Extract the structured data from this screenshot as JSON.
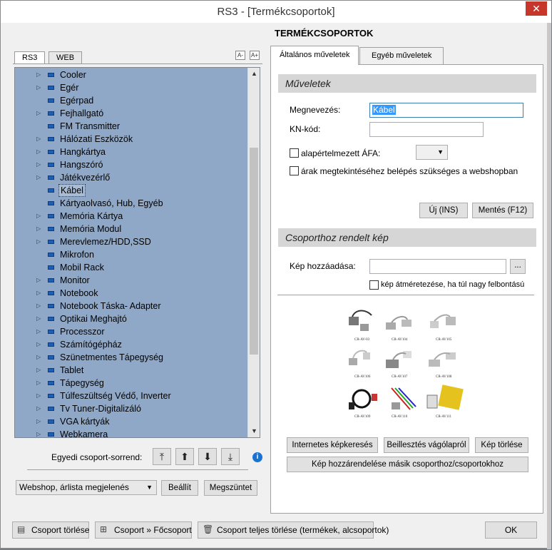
{
  "window": {
    "title": "RS3 - [Termékcsoportok]"
  },
  "heading": "TERMÉKCSOPORTOK",
  "left_tabs": [
    {
      "label": "RS3",
      "active": true
    },
    {
      "label": "WEB",
      "active": false
    }
  ],
  "tree": {
    "selected": "Kábel",
    "items": [
      {
        "label": "Cooler",
        "expandable": true
      },
      {
        "label": "Egér",
        "expandable": true
      },
      {
        "label": "Egérpad",
        "expandable": false
      },
      {
        "label": "Fejhallgató",
        "expandable": true
      },
      {
        "label": "FM Transmitter",
        "expandable": false
      },
      {
        "label": "Hálózati Eszközök",
        "expandable": true
      },
      {
        "label": "Hangkártya",
        "expandable": true
      },
      {
        "label": "Hangszóró",
        "expandable": true
      },
      {
        "label": "Játékvezérlő",
        "expandable": true
      },
      {
        "label": "Kábel",
        "expandable": false
      },
      {
        "label": "Kártyaolvasó, Hub, Egyéb",
        "expandable": false
      },
      {
        "label": "Memória Kártya",
        "expandable": true
      },
      {
        "label": "Memória Modul",
        "expandable": true
      },
      {
        "label": "Merevlemez/HDD,SSD",
        "expandable": true
      },
      {
        "label": "Mikrofon",
        "expandable": false
      },
      {
        "label": "Mobil Rack",
        "expandable": false
      },
      {
        "label": "Monitor",
        "expandable": true
      },
      {
        "label": "Notebook",
        "expandable": true
      },
      {
        "label": "Notebook Táska- Adapter",
        "expandable": true
      },
      {
        "label": "Optikai Meghajtó",
        "expandable": true
      },
      {
        "label": "Processzor",
        "expandable": true
      },
      {
        "label": "Számítógépház",
        "expandable": true
      },
      {
        "label": "Szünetmentes Tápegység",
        "expandable": true
      },
      {
        "label": "Tablet",
        "expandable": true
      },
      {
        "label": "Tápegység",
        "expandable": true
      },
      {
        "label": "Túlfeszültség Védő, Inverter",
        "expandable": true
      },
      {
        "label": "Tv Tuner-Digitalizáló",
        "expandable": true
      },
      {
        "label": "VGA kártyák",
        "expandable": true
      },
      {
        "label": "Webkamera",
        "expandable": true
      }
    ]
  },
  "sort": {
    "label": "Egyedi csoport-sorrend:"
  },
  "display_select": {
    "value": "Webshop, árlista megjelenés"
  },
  "left_buttons": {
    "set": "Beállít",
    "cancel": "Megszüntet"
  },
  "right_tabs": [
    {
      "label": "Általános műveletek",
      "active": true
    },
    {
      "label": "Egyéb műveletek",
      "active": false
    }
  ],
  "operations": {
    "header": "Műveletek",
    "name_label": "Megnevezés:",
    "name_value": "Kábel",
    "kn_label": "KN-kód:",
    "kn_value": "",
    "vat_label": "alapértelmezett ÁFA:",
    "login_label": "árak megtekintéséhez belépés szükséges a webshopban",
    "new_button": "Új (INS)",
    "save_button": "Mentés (F12)"
  },
  "image_section": {
    "header": "Csoporthoz rendelt kép",
    "add_label": "Kép hozzáadása:",
    "add_value": "",
    "browse_label": "...",
    "resize_label": "kép átméretezése, ha túl nagy felbontású",
    "captions": [
      "CR-AV-03",
      "CR-AV104",
      "CR-AV105",
      "CR-AV106",
      "CR-AV107",
      "CR-AV108",
      "CR-AV109",
      "CR-AV110",
      "CR-AV111"
    ],
    "search_button": "Internetes képkeresés",
    "paste_button": "Beillesztés vágólapról",
    "delete_button": "Kép törlése",
    "assign_button": "Kép hozzárendelése másik csoporthoz/csoportokhoz"
  },
  "footer": {
    "delete_group": "Csoport törlése",
    "to_main": "Csoport » Főcsoport",
    "delete_all": "Csoport teljes törlése (termékek, alcsoportok)",
    "ok": "OK"
  },
  "colors": {
    "tree_bg": "#8fa8c8",
    "close": "#c7362b",
    "selection": "#3399ff"
  }
}
